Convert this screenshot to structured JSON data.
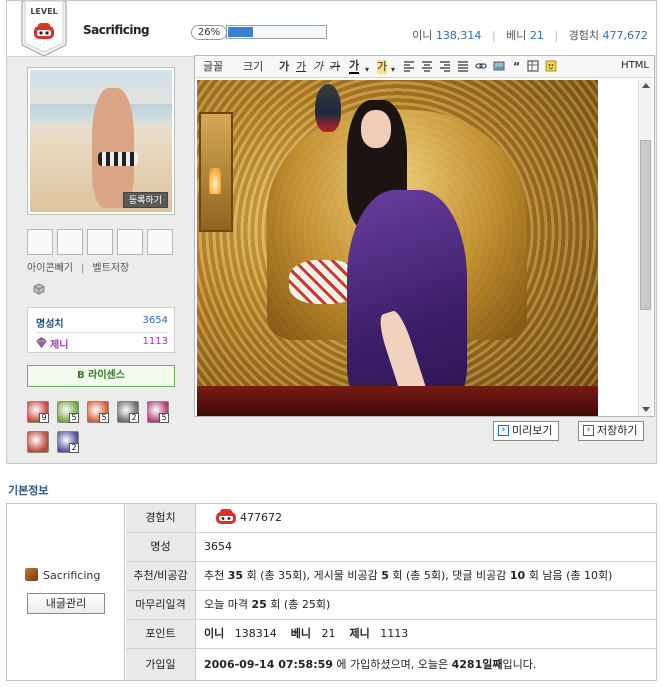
{
  "topbar": {
    "level_label": "LEVEL",
    "nickname": "Sacrificing",
    "progress_percent": 26,
    "progress_label": "26%",
    "stats": [
      {
        "label": "이니",
        "value": "138,314"
      },
      {
        "label": "베니",
        "value": "21"
      },
      {
        "label": "경험치",
        "value": "477,672"
      }
    ]
  },
  "profile": {
    "register_label": "등록하기",
    "slot_links": [
      "아이콘빼기",
      "|",
      "벨트저장"
    ],
    "fame_label": "명성치",
    "fame_value": "3654",
    "zeni_label": "제니",
    "zeni_value": "1113",
    "license_label": "B 라이센스",
    "items": [
      {
        "name": "item-slot-1",
        "count": "9",
        "color": "#c7463a"
      },
      {
        "name": "item-slot-2",
        "count": "5",
        "color": "#6fa83a"
      },
      {
        "name": "item-slot-3",
        "count": "5",
        "color": "#d85a2a"
      },
      {
        "name": "item-slot-4",
        "count": "2",
        "color": "#6a6a6a"
      },
      {
        "name": "item-slot-5",
        "count": "5",
        "color": "#b23a7a"
      },
      {
        "name": "item-slot-6",
        "count": "",
        "color": "#b94a3a"
      },
      {
        "name": "item-slot-7",
        "count": "2",
        "color": "#4a4f9a"
      }
    ]
  },
  "editor": {
    "font_label": "글꼴",
    "size_label": "크기",
    "html_label": "HTML",
    "preview_label": "미리보기",
    "save_label": "저장하기"
  },
  "info": {
    "section_title": "기본정보",
    "nickname": "Sacrificing",
    "posts_button": "내글관리",
    "rows": {
      "exp_label": "경험치",
      "exp_value": "477672",
      "fame_label": "명성",
      "fame_value": "3654",
      "recommend_label": "추천/비공감",
      "rec_1": "추천",
      "rec_2": "35",
      "rec_3": "회 (총 35회), 게시물 비공감",
      "rec_4": "5",
      "rec_5": "회 (총 5회), 댓글 비공감",
      "rec_6": "10",
      "rec_7": "회 남음 (총 10회)",
      "closing_label": "마무리일격",
      "closing_1": "오늘 마격",
      "closing_2": "25",
      "closing_3": "회 (총 25회)",
      "points_label": "포인트",
      "p_ini_label": "이니",
      "p_ini_value": "138314",
      "p_beni_label": "베니",
      "p_beni_value": "21",
      "p_zeni_label": "제니",
      "p_zeni_value": "1113",
      "joined_label": "가입일",
      "joined_1": "2006-09-14 07:58:59",
      "joined_2": "에 가입하셨으며, 오늘은",
      "joined_3": "4281일째",
      "joined_4": "입니다."
    }
  },
  "colors": {
    "accent_blue": "#2d6fb7",
    "zeni_purple": "#a136b6",
    "license_green": "#2f7c1f",
    "section_title": "#2c5a8c"
  }
}
